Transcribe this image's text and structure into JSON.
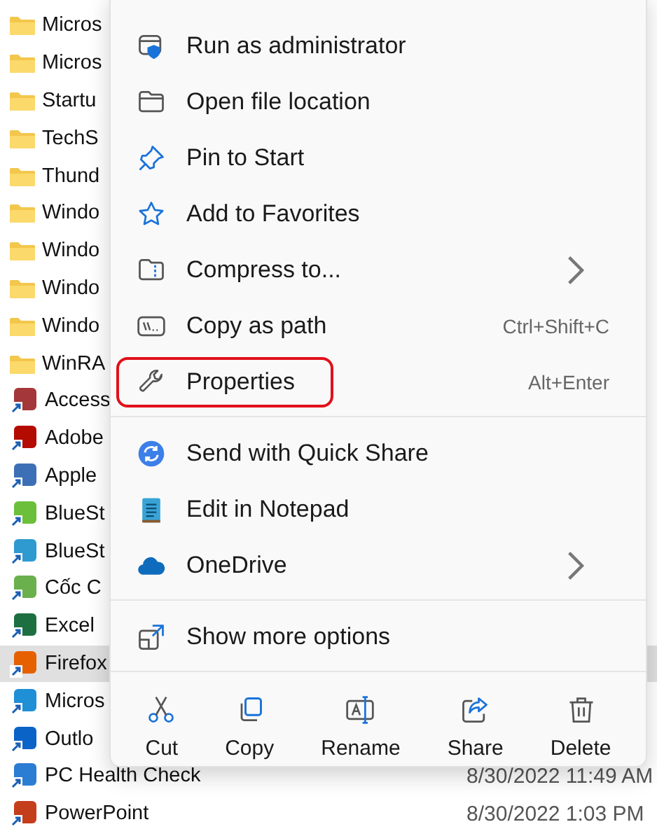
{
  "files": [
    {
      "name": "Micros",
      "kind": "folder",
      "selected": false
    },
    {
      "name": "Micros",
      "kind": "folder",
      "selected": false
    },
    {
      "name": "Startu",
      "kind": "folder",
      "selected": false
    },
    {
      "name": "TechS",
      "kind": "folder",
      "selected": false
    },
    {
      "name": "Thund",
      "kind": "folder",
      "selected": false
    },
    {
      "name": "Windo",
      "kind": "folder",
      "selected": false
    },
    {
      "name": "Windo",
      "kind": "folder",
      "selected": false
    },
    {
      "name": "Windo",
      "kind": "folder",
      "selected": false
    },
    {
      "name": "Windo",
      "kind": "folder",
      "selected": false
    },
    {
      "name": "WinRA",
      "kind": "folder",
      "selected": false
    },
    {
      "name": "Access",
      "kind": "shortcut",
      "color": "#a4373a",
      "selected": false
    },
    {
      "name": "Adobe",
      "kind": "shortcut",
      "color": "#b30b00",
      "selected": false
    },
    {
      "name": "Apple",
      "kind": "shortcut",
      "color": "#3d6fb6",
      "selected": false
    },
    {
      "name": "BlueSt",
      "kind": "shortcut",
      "color": "#6cbf3a",
      "selected": false
    },
    {
      "name": "BlueSt",
      "kind": "shortcut",
      "color": "#2e9ad0",
      "selected": false
    },
    {
      "name": "Cốc C",
      "kind": "shortcut",
      "color": "#6ab04c",
      "selected": false
    },
    {
      "name": "Excel",
      "kind": "shortcut",
      "color": "#1d6f42",
      "selected": false
    },
    {
      "name": "Firefox",
      "kind": "shortcut",
      "color": "#e66000",
      "selected": true
    },
    {
      "name": "Micros",
      "kind": "shortcut",
      "color": "#1f8fd6",
      "selected": false
    },
    {
      "name": "Outlo",
      "kind": "shortcut",
      "color": "#0a64c8",
      "selected": false
    },
    {
      "name": "PC Health Check",
      "kind": "shortcut",
      "color": "#2b7cd3",
      "selected": false,
      "date": "8/30/2022 11:49 AM"
    },
    {
      "name": "PowerPoint",
      "kind": "shortcut",
      "color": "#c43e1c",
      "selected": false,
      "date": "8/30/2022 1:03 PM"
    }
  ],
  "menu": {
    "groups": [
      [
        {
          "label": "Run as administrator",
          "submenu": false,
          "highlighted": false
        },
        {
          "label": "Open file location",
          "submenu": false,
          "highlighted": false
        },
        {
          "label": "Pin to Start",
          "submenu": false,
          "highlighted": false
        },
        {
          "label": "Add to Favorites",
          "submenu": false,
          "highlighted": false
        },
        {
          "label": "Compress to...",
          "submenu": true,
          "highlighted": false
        },
        {
          "label": "Copy as path",
          "shortcut": "Ctrl+Shift+C",
          "submenu": false,
          "highlighted": false
        },
        {
          "label": "Properties",
          "shortcut": "Alt+Enter",
          "submenu": false,
          "highlighted": true
        }
      ],
      [
        {
          "label": "Send with Quick Share",
          "submenu": false,
          "highlighted": false
        },
        {
          "label": "Edit in Notepad",
          "submenu": false,
          "highlighted": false
        },
        {
          "label": "OneDrive",
          "submenu": true,
          "highlighted": false
        }
      ],
      [
        {
          "label": "Show more options",
          "submenu": false,
          "highlighted": false
        }
      ]
    ],
    "actions": [
      "Cut",
      "Copy",
      "Rename",
      "Share",
      "Delete"
    ]
  }
}
